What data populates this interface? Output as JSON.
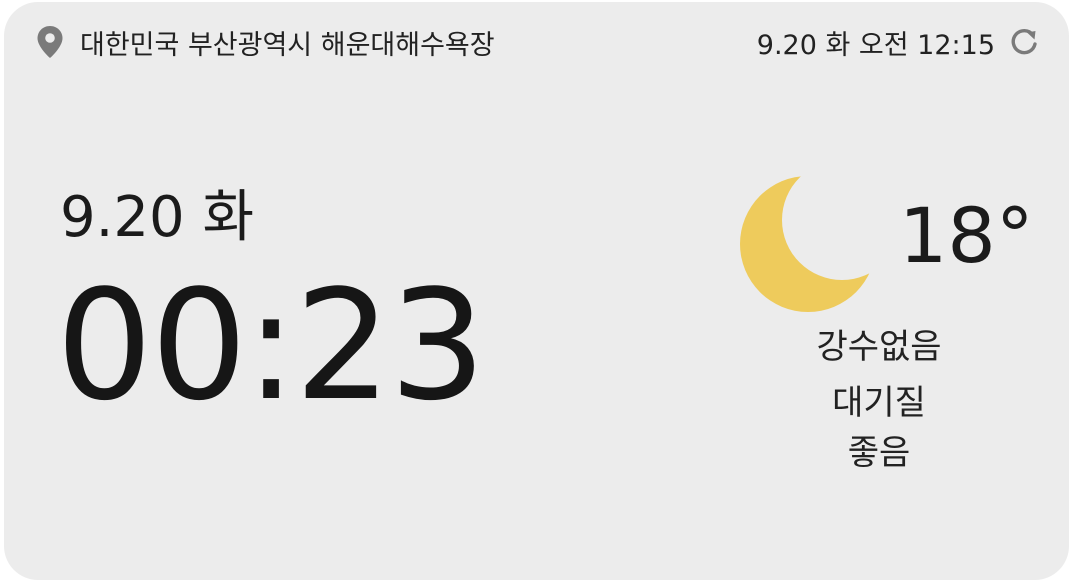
{
  "header": {
    "location": "대한민국 부산광역시 해운대해수욕장",
    "updated": "9.20 화 오전 12:15"
  },
  "clock": {
    "date": "9.20 화",
    "time": "00:23"
  },
  "weather": {
    "icon": "moon-icon",
    "temperature": "18°",
    "precipitation": "강수없음",
    "air_quality_label": "대기질",
    "air_quality_value": "좋음"
  },
  "colors": {
    "background": "#ececec",
    "moon": "#eecb5c",
    "text": "#1e1e1e",
    "icon": "#7a7a7a"
  }
}
